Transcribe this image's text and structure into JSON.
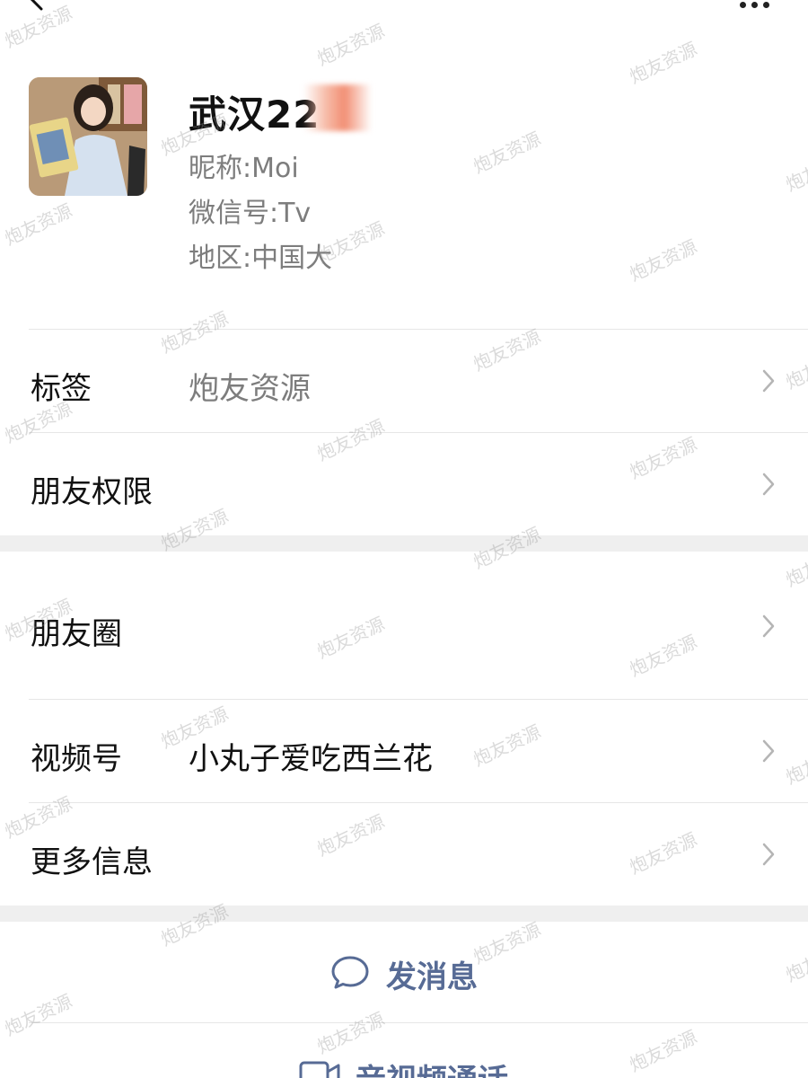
{
  "header": {
    "back_icon": "chevron-left-icon",
    "more_icon": "more-dots-icon"
  },
  "profile": {
    "name": "武汉22",
    "nickname_label": "昵称:",
    "nickname_value": "Moi",
    "wechat_id_label": "微信号:",
    "wechat_id_value": "Tv",
    "region_label": "地区:",
    "region_value": "中国大"
  },
  "rows": {
    "tags": {
      "label": "标签",
      "value": "炮友资源"
    },
    "permissions": {
      "label": "朋友权限"
    },
    "moments": {
      "label": "朋友圈"
    },
    "channels": {
      "label": "视频号",
      "value": "小丸子爱吃西兰花"
    },
    "more_info": {
      "label": "更多信息"
    }
  },
  "actions": {
    "send_message": "发消息",
    "av_call": "音视频通话"
  },
  "watermark": "炮友资源",
  "colors": {
    "link_blue": "#576b95",
    "label_gray": "#7d7d7d",
    "section_gap": "#efefef",
    "divider": "#e6e6e6"
  }
}
